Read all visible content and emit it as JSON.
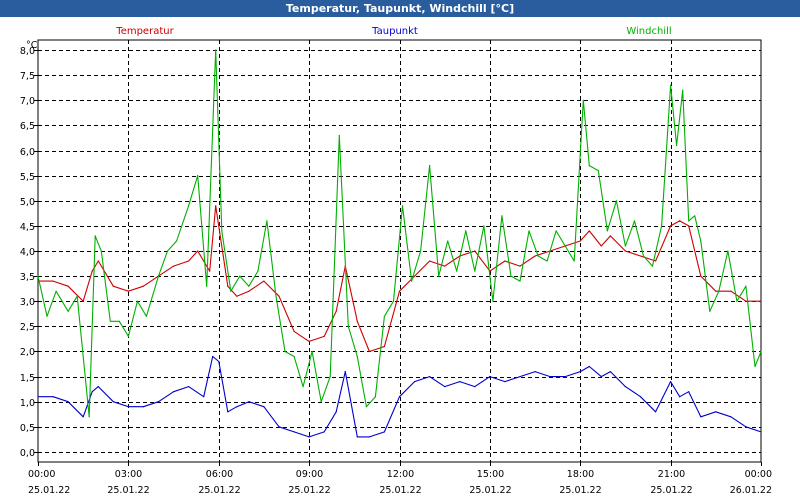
{
  "window": {
    "title": "Temperatur, Taupunkt, Windchill [°C]"
  },
  "colors": {
    "titlebar": "#2a5d9e",
    "temperatur": "#cc0000",
    "taupunkt": "#0000cc",
    "windchill": "#00b000",
    "grid": "#000000"
  },
  "chart_data": {
    "type": "line",
    "title": "Temperatur, Taupunkt, Windchill [°C]",
    "ylabel": "°C",
    "ylim": [
      -0.2,
      8.2
    ],
    "xlim": [
      0,
      24
    ],
    "grid": true,
    "legend_placement": "top",
    "yticks": [
      0,
      0.5,
      1,
      1.5,
      2,
      2.5,
      3,
      3.5,
      4,
      4.5,
      5,
      5.5,
      6,
      6.5,
      7,
      7.5,
      8
    ],
    "ytick_labels": [
      "0,0",
      "0,5",
      "1,0",
      "1,5",
      "2,0",
      "2,5",
      "3,0",
      "3,5",
      "4,0",
      "4,5",
      "5,0",
      "5,5",
      "6,0",
      "6,5",
      "7,0",
      "7,5",
      "8,0"
    ],
    "xticks": [
      {
        "x": 0,
        "time": "00:00",
        "date": "25.01.22"
      },
      {
        "x": 3,
        "time": "03:00",
        "date": "25.01.22"
      },
      {
        "x": 6,
        "time": "06:00",
        "date": "25.01.22"
      },
      {
        "x": 9,
        "time": "09:00",
        "date": "25.01.22"
      },
      {
        "x": 12,
        "time": "12:00",
        "date": "25.01.22"
      },
      {
        "x": 15,
        "time": "15:00",
        "date": "25.01.22"
      },
      {
        "x": 18,
        "time": "18:00",
        "date": "25.01.22"
      },
      {
        "x": 21,
        "time": "21:00",
        "date": "25.01.22"
      },
      {
        "x": 24,
        "time": "00:00",
        "date": "26.01.22"
      }
    ],
    "series": [
      {
        "name": "Temperatur",
        "color": "#cc0000",
        "x": [
          0,
          0.5,
          1,
          1.5,
          1.8,
          2,
          2.5,
          3,
          3.5,
          4,
          4.5,
          5,
          5.3,
          5.7,
          5.9,
          6.3,
          6.6,
          7,
          7.5,
          8,
          8.5,
          9,
          9.5,
          9.9,
          10.2,
          10.6,
          11,
          11.5,
          12,
          12.5,
          13,
          13.5,
          14,
          14.5,
          15,
          15.5,
          16,
          16.5,
          17,
          17.5,
          18,
          18.3,
          18.7,
          19,
          19.5,
          20,
          20.5,
          21,
          21.3,
          21.6,
          22,
          22.5,
          23,
          23.5,
          24
        ],
        "y": [
          3.4,
          3.4,
          3.3,
          3.0,
          3.6,
          3.8,
          3.3,
          3.2,
          3.3,
          3.5,
          3.7,
          3.8,
          4.0,
          3.6,
          4.9,
          3.3,
          3.1,
          3.2,
          3.4,
          3.1,
          2.4,
          2.2,
          2.3,
          2.8,
          3.7,
          2.6,
          2.0,
          2.1,
          3.2,
          3.5,
          3.8,
          3.7,
          3.9,
          4.0,
          3.6,
          3.8,
          3.7,
          3.9,
          4.0,
          4.1,
          4.2,
          4.4,
          4.1,
          4.3,
          4.0,
          3.9,
          3.8,
          4.5,
          4.6,
          4.5,
          3.5,
          3.2,
          3.2,
          3.0,
          3.0
        ]
      },
      {
        "name": "Taupunkt",
        "color": "#0000cc",
        "x": [
          0,
          0.5,
          1,
          1.5,
          1.8,
          2,
          2.5,
          3,
          3.5,
          4,
          4.5,
          5,
          5.5,
          5.8,
          6.0,
          6.3,
          6.6,
          7,
          7.5,
          8,
          8.5,
          9,
          9.5,
          9.9,
          10.2,
          10.6,
          11,
          11.5,
          12,
          12.5,
          13,
          13.5,
          14,
          14.5,
          15,
          15.5,
          16,
          16.5,
          17,
          17.5,
          18,
          18.3,
          18.7,
          19,
          19.5,
          20,
          20.5,
          21,
          21.3,
          21.6,
          22,
          22.5,
          23,
          23.5,
          24
        ],
        "y": [
          1.1,
          1.1,
          1.0,
          0.7,
          1.2,
          1.3,
          1.0,
          0.9,
          0.9,
          1.0,
          1.2,
          1.3,
          1.1,
          1.9,
          1.8,
          0.8,
          0.9,
          1.0,
          0.9,
          0.5,
          0.4,
          0.3,
          0.4,
          0.8,
          1.6,
          0.3,
          0.3,
          0.4,
          1.1,
          1.4,
          1.5,
          1.3,
          1.4,
          1.3,
          1.5,
          1.4,
          1.5,
          1.6,
          1.5,
          1.5,
          1.6,
          1.7,
          1.5,
          1.6,
          1.3,
          1.1,
          0.8,
          1.4,
          1.1,
          1.2,
          0.7,
          0.8,
          0.7,
          0.5,
          0.4
        ]
      },
      {
        "name": "Windchill",
        "color": "#00b000",
        "x": [
          0,
          0.3,
          0.6,
          1,
          1.3,
          1.7,
          1.9,
          2.1,
          2.4,
          2.7,
          3,
          3.3,
          3.6,
          4,
          4.3,
          4.6,
          5,
          5.3,
          5.6,
          5.9,
          6.1,
          6.4,
          6.7,
          7,
          7.3,
          7.6,
          7.9,
          8.2,
          8.5,
          8.8,
          9.1,
          9.4,
          9.7,
          10,
          10.3,
          10.6,
          10.9,
          11.2,
          11.5,
          11.8,
          12.1,
          12.4,
          12.7,
          13,
          13.3,
          13.6,
          13.9,
          14.2,
          14.5,
          14.8,
          15.1,
          15.4,
          15.7,
          16,
          16.3,
          16.6,
          16.9,
          17.2,
          17.5,
          17.8,
          18.1,
          18.3,
          18.6,
          18.9,
          19.2,
          19.5,
          19.8,
          20.1,
          20.4,
          20.7,
          21,
          21.2,
          21.4,
          21.6,
          21.8,
          22,
          22.3,
          22.6,
          22.9,
          23.2,
          23.5,
          23.8,
          24
        ],
        "y": [
          3.5,
          2.7,
          3.2,
          2.8,
          3.1,
          0.7,
          4.3,
          4.0,
          2.6,
          2.6,
          2.3,
          3.0,
          2.7,
          3.5,
          4.0,
          4.2,
          4.9,
          5.5,
          3.3,
          8.0,
          4.4,
          3.2,
          3.5,
          3.3,
          3.6,
          4.6,
          3.1,
          2.0,
          1.9,
          1.3,
          2.0,
          1.0,
          1.5,
          6.3,
          2.5,
          1.9,
          0.9,
          1.1,
          2.7,
          3.0,
          4.9,
          3.4,
          4.0,
          5.7,
          3.5,
          4.2,
          3.6,
          4.4,
          3.6,
          4.5,
          3.0,
          4.7,
          3.5,
          3.4,
          4.4,
          3.9,
          3.8,
          4.4,
          4.1,
          3.8,
          7.0,
          5.7,
          5.6,
          4.4,
          5.0,
          4.1,
          4.6,
          3.9,
          3.7,
          4.5,
          7.3,
          6.1,
          7.2,
          4.6,
          4.7,
          4.2,
          2.8,
          3.2,
          4.0,
          3.0,
          3.3,
          1.7,
          2.0
        ]
      }
    ]
  }
}
